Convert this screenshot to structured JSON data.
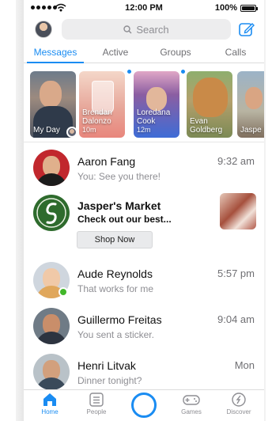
{
  "status_bar": {
    "time": "12:00 PM",
    "battery_percent": "100%"
  },
  "search": {
    "placeholder": "Search"
  },
  "tabs": [
    {
      "label": "Messages",
      "active": true
    },
    {
      "label": "Active",
      "active": false
    },
    {
      "label": "Groups",
      "active": false
    },
    {
      "label": "Calls",
      "active": false
    }
  ],
  "stories": [
    {
      "name": "My Day",
      "time": "",
      "unseen": false
    },
    {
      "name": "Brendan Dalonzo",
      "time": "10m",
      "unseen": true
    },
    {
      "name": "Loredana Cook",
      "time": "12m",
      "unseen": true
    },
    {
      "name": "Evan Goldberg",
      "time": "",
      "unseen": false
    },
    {
      "name": "Jaspe Ster",
      "time": "",
      "unseen": false
    }
  ],
  "conversations": [
    {
      "name": "Aaron Fang",
      "preview": "You: See you there!",
      "time": "9:32 am",
      "online": false
    },
    {
      "name": "Jasper's Market",
      "preview": "Check out our best...",
      "button": "Shop Now",
      "sponsored": true
    },
    {
      "name": "Aude Reynolds",
      "preview": "That works for me",
      "time": "5:57 pm",
      "online": true
    },
    {
      "name": "Guillermo Freitas",
      "preview": "You sent a sticker.",
      "time": "9:04 am",
      "online": false
    },
    {
      "name": "Henri Litvak",
      "preview": "Dinner tonight?",
      "time": "Mon",
      "online": false
    }
  ],
  "bottom_nav": [
    {
      "label": "Home",
      "icon": "home-icon",
      "active": true
    },
    {
      "label": "People",
      "icon": "people-icon",
      "active": false
    },
    {
      "label": "",
      "icon": "camera-icon",
      "active": false
    },
    {
      "label": "Games",
      "icon": "gamepad-icon",
      "active": false
    },
    {
      "label": "Discover",
      "icon": "compass-icon",
      "active": false
    }
  ],
  "colors": {
    "accent": "#1a8cf2",
    "online": "#42b72a",
    "muted_text": "#8e8e93"
  }
}
